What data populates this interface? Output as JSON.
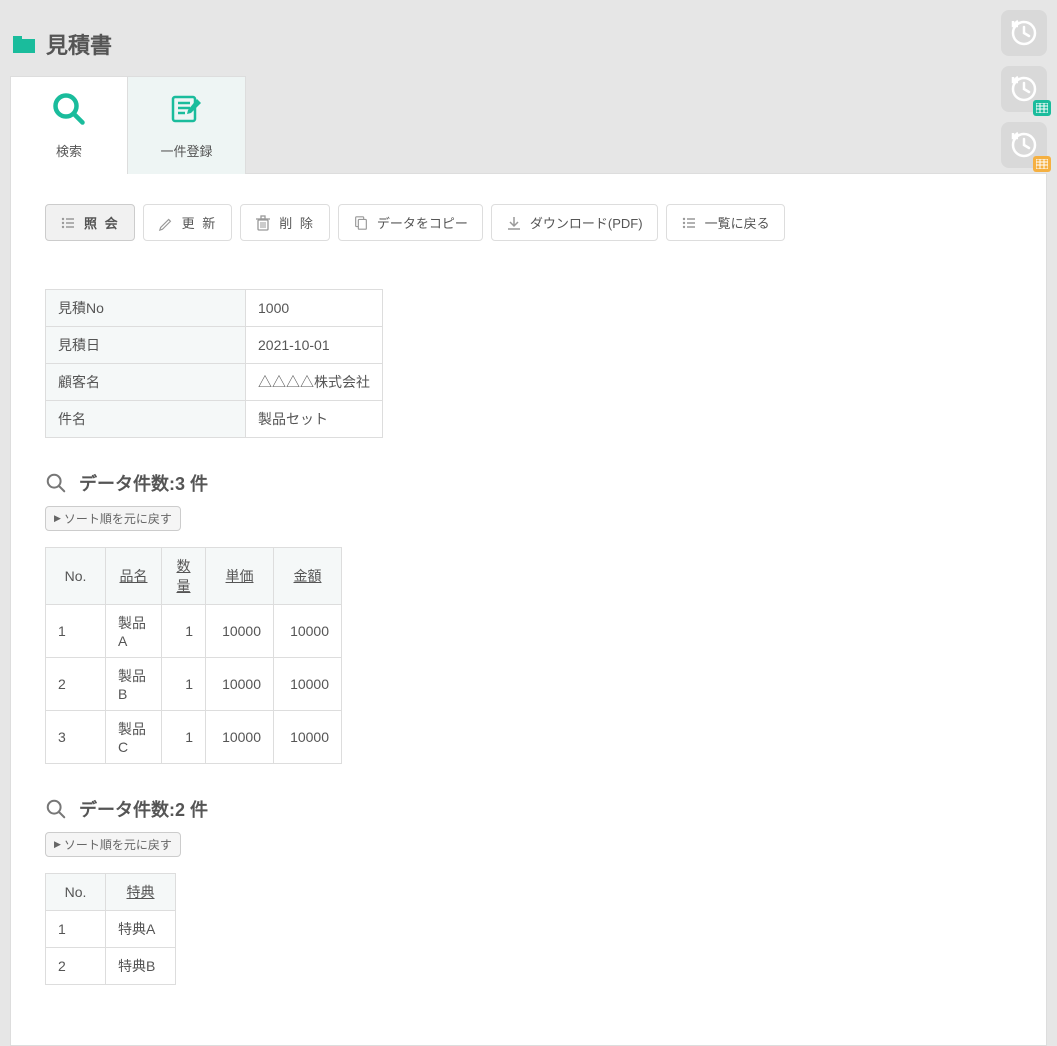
{
  "header": {
    "title": "見積書"
  },
  "tabs": {
    "search": "検索",
    "register": "一件登録"
  },
  "toolbar": {
    "view": "照 会",
    "update": "更 新",
    "delete": "削 除",
    "copy": "データをコピー",
    "download": "ダウンロード(PDF)",
    "back": "一覧に戻る"
  },
  "record": {
    "labels": {
      "no": "見積No",
      "date": "見積日",
      "customer": "顧客名",
      "subject": "件名"
    },
    "values": {
      "no": "1000",
      "date": "2021-10-01",
      "customer": "△△△△株式会社",
      "subject": "製品セット"
    }
  },
  "section1": {
    "heading": "データ件数:3 件",
    "reset_sort": "ソート順を元に戻す",
    "columns": {
      "no": "No.",
      "name": "品名",
      "qty": "数量",
      "price": "単価",
      "amount": "金額"
    },
    "rows": [
      {
        "no": "1",
        "name": "製品A",
        "qty": "1",
        "price": "10000",
        "amount": "10000"
      },
      {
        "no": "2",
        "name": "製品B",
        "qty": "1",
        "price": "10000",
        "amount": "10000"
      },
      {
        "no": "3",
        "name": "製品C",
        "qty": "1",
        "price": "10000",
        "amount": "10000"
      }
    ]
  },
  "section2": {
    "heading": "データ件数:2 件",
    "reset_sort": "ソート順を元に戻す",
    "columns": {
      "no": "No.",
      "bonus": "特典"
    },
    "rows": [
      {
        "no": "1",
        "bonus": "特典A"
      },
      {
        "no": "2",
        "bonus": "特典B"
      }
    ]
  }
}
